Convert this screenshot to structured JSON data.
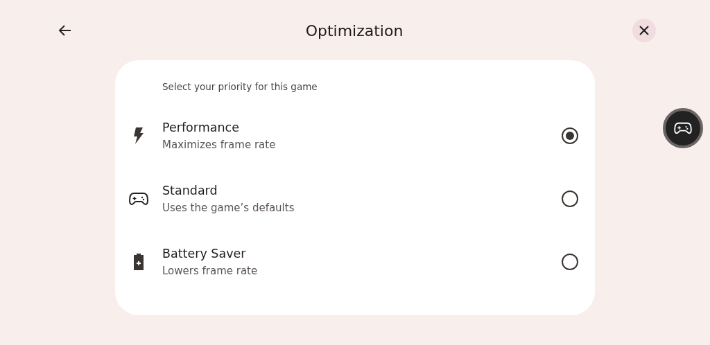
{
  "header": {
    "title": "Optimization"
  },
  "card": {
    "heading": "Select your priority for this game",
    "options": [
      {
        "kind": "bolt",
        "label": "Performance",
        "description": "Maximizes frame rate",
        "selected": true
      },
      {
        "kind": "gamepad",
        "label": "Standard",
        "description": "Uses the game’s defaults",
        "selected": false
      },
      {
        "kind": "battery",
        "label": "Battery Saver",
        "description": "Lowers frame rate",
        "selected": false
      }
    ]
  }
}
